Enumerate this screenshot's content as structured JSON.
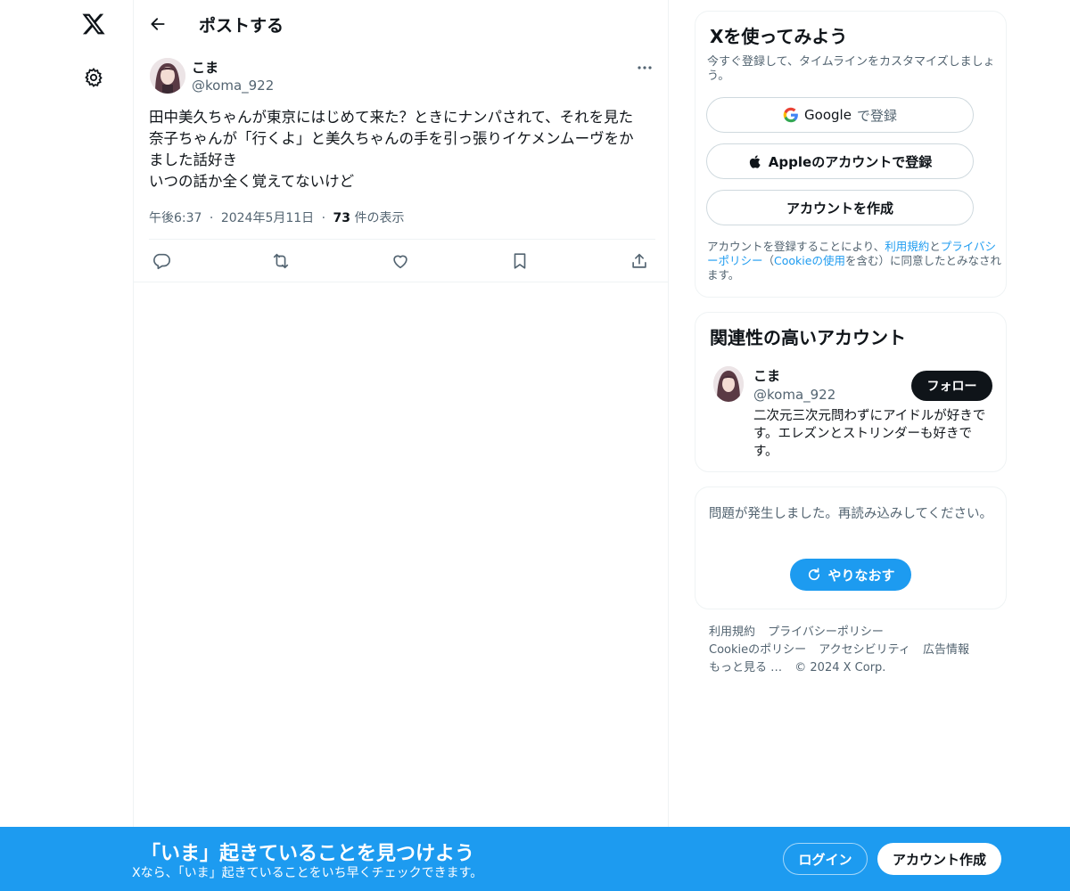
{
  "header": {
    "title": "ポストする"
  },
  "tweet": {
    "author_name": "こま",
    "author_handle": "@koma_922",
    "text": "田中美久ちゃんが東京にはじめて来た？ときにナンパされて、それを見た\n奈子ちゃんが「行くよ」と美久ちゃんの手を引っ張りイケメンムーヴをか\nました話好き\nいつの話か全く覚えてないけど",
    "time": "午後6:37",
    "date": "2024年5月11日",
    "views_count": "73",
    "views_label": "件の表示",
    "separator": "·"
  },
  "signup_card": {
    "title": "Xを使ってみよう",
    "subtitle": "今すぐ登録して、タイムラインをカスタマイズしましょう。",
    "google_brand": "Google",
    "google_suffix": "で登録",
    "apple_label": "Appleのアカウントで登録",
    "create_label": "アカウントを作成",
    "terms_prefix": "アカウントを登録することにより、",
    "terms_link1": "利用規約",
    "terms_and": "と",
    "terms_link2": "プライバシーポリシー",
    "terms_paren_open": "（",
    "terms_link3": "Cookieの使用",
    "terms_suffix": "を含む）に同意したとみなされます。"
  },
  "recommend_card": {
    "title": "関連性の高いアカウント",
    "name": "こま",
    "handle": "@koma_922",
    "follow_label": "フォロー",
    "bio": "二次元三次元問わずにアイドルが好きです。エレズンとストリンダーも好きです。"
  },
  "error_card": {
    "message": "問題が発生しました。再読み込みしてください。",
    "retry_label": "やりなおす"
  },
  "footer": {
    "row1": [
      "利用規約",
      "プライバシーポリシー"
    ],
    "row2": [
      "Cookieのポリシー",
      "アクセシビリティ",
      "広告情報"
    ],
    "row3": [
      "もっと見る …",
      "© 2024 X Corp."
    ]
  },
  "banner": {
    "title": "「いま」起きていることを見つけよう",
    "subtitle": "Xなら、「いま」起きていることをいち早くチェックできます。",
    "login_label": "ログイン",
    "signup_label": "アカウント作成"
  },
  "icons": {
    "logo": "x-logo-icon",
    "settings": "gear-icon",
    "back": "arrow-left-icon",
    "more": "more-horizontal-icon",
    "reply": "reply-icon",
    "retweet": "retweet-icon",
    "like": "heart-icon",
    "bookmark": "bookmark-icon",
    "share": "share-icon"
  },
  "colors": {
    "accent": "#1d9bf0",
    "text": "#0f1419",
    "muted": "#536471",
    "border": "#eff3f4"
  }
}
